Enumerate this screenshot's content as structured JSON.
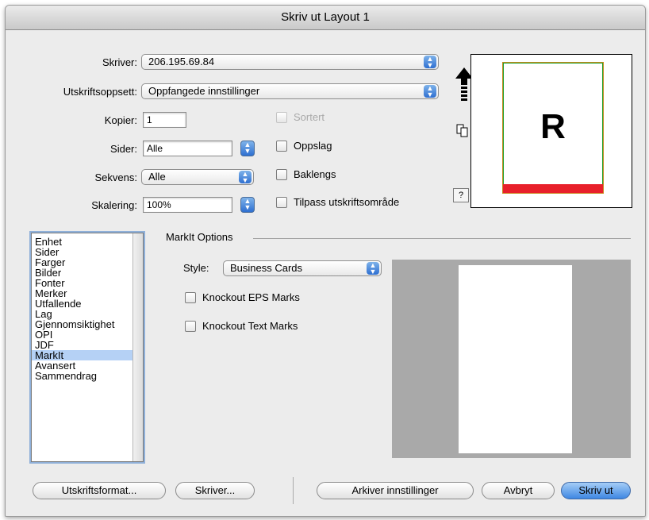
{
  "window": {
    "title": "Skriv ut Layout 1"
  },
  "settings": {
    "printer_label": "Skriver:",
    "printer_value": "206.195.69.84",
    "preset_label": "Utskriftsoppsett:",
    "preset_value": "Oppfangede innstillinger",
    "copies_label": "Kopier:",
    "copies_value": "1",
    "pages_label": "Sider:",
    "pages_value": "Alle",
    "sequence_label": "Sekvens:",
    "sequence_value": "Alle",
    "scale_label": "Skalering:",
    "scale_value": "100%"
  },
  "options": {
    "collate": "Sortert",
    "spreads": "Oppslag",
    "reverse": "Baklengs",
    "fit": "Tilpass utskriftsområde"
  },
  "preview": {
    "letter": "R",
    "help": "?"
  },
  "sidebar": {
    "items": [
      "Enhet",
      "Sider",
      "Farger",
      "Bilder",
      "Fonter",
      "Merker",
      "Utfallende",
      "Lag",
      "Gjennomsiktighet",
      "OPI",
      "JDF",
      "MarkIt",
      "Avansert",
      "Sammendrag"
    ],
    "selected": "MarkIt"
  },
  "markit": {
    "group_title": "MarkIt Options",
    "style_label": "Style:",
    "style_value": "Business Cards",
    "knockout_eps": "Knockout EPS Marks",
    "knockout_text": "Knockout Text Marks"
  },
  "buttons": {
    "page_setup": "Utskriftsformat...",
    "printer": "Skriver...",
    "save_settings": "Arkiver innstillinger",
    "cancel": "Avbryt",
    "print": "Skriv ut"
  },
  "colors": {
    "accent": "#3e87e3",
    "preview_bar": "#e8202a",
    "preview_border_green": "#1fa02a"
  }
}
